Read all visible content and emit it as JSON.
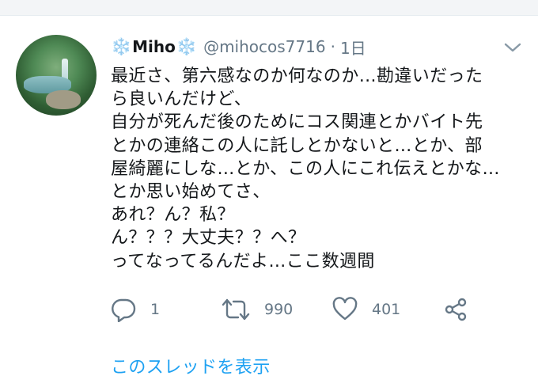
{
  "tweet": {
    "author": {
      "display_name": "Miho",
      "flake_left": "❄️",
      "flake_right": "❄️",
      "handle": "@mihocos7716",
      "separator": "·",
      "time": "1日"
    },
    "lines": [
      "最近さ、第六感なのか何なのか…勘違いだった",
      "ら良いんだけど、",
      "自分が死んだ後のためにコス関連とかバイト先",
      "とかの連絡この人に託しとかないと…とか、部",
      "屋綺麗にしな…とか、この人にこれ伝えとかな…",
      "とか思い始めてさ、",
      "あれ？ん？私？",
      "ん？？？大丈夫？？へ？",
      "ってなってるんだよ…ここ数週間"
    ],
    "actions": {
      "reply_count": "1",
      "retweet_count": "990",
      "like_count": "401"
    },
    "thread_link": "このスレッドを表示"
  },
  "colors": {
    "text": "#14171a",
    "secondary": "#657786",
    "link": "#1da1f2",
    "snowflake": "#5aa6e6"
  },
  "icons": [
    "avatar-image",
    "more-caret-icon",
    "reply-icon",
    "retweet-icon",
    "like-icon",
    "share-icon"
  ]
}
